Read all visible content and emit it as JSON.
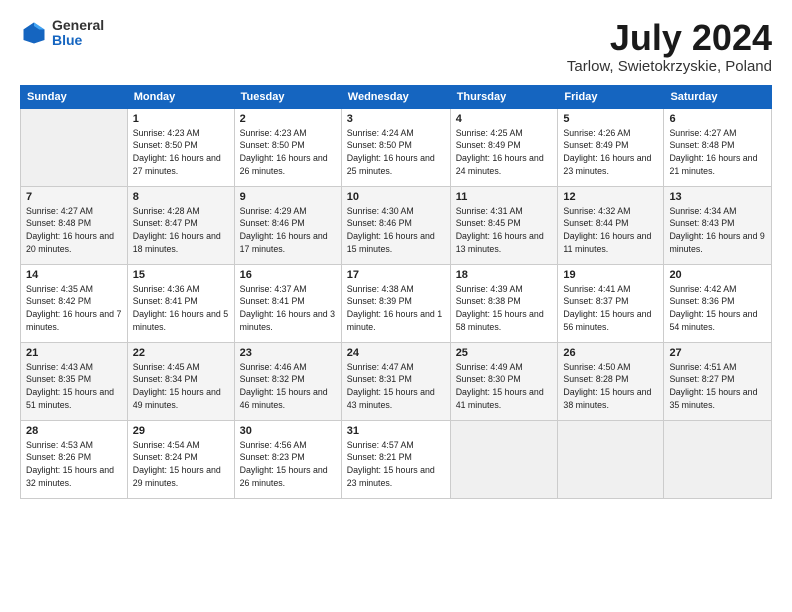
{
  "header": {
    "logo_general": "General",
    "logo_blue": "Blue",
    "month_title": "July 2024",
    "location": "Tarlow, Swietokrzyskie, Poland"
  },
  "days_of_week": [
    "Sunday",
    "Monday",
    "Tuesday",
    "Wednesday",
    "Thursday",
    "Friday",
    "Saturday"
  ],
  "weeks": [
    [
      {
        "day": "",
        "info": ""
      },
      {
        "day": "1",
        "info": "Sunrise: 4:23 AM\nSunset: 8:50 PM\nDaylight: 16 hours\nand 27 minutes."
      },
      {
        "day": "2",
        "info": "Sunrise: 4:23 AM\nSunset: 8:50 PM\nDaylight: 16 hours\nand 26 minutes."
      },
      {
        "day": "3",
        "info": "Sunrise: 4:24 AM\nSunset: 8:50 PM\nDaylight: 16 hours\nand 25 minutes."
      },
      {
        "day": "4",
        "info": "Sunrise: 4:25 AM\nSunset: 8:49 PM\nDaylight: 16 hours\nand 24 minutes."
      },
      {
        "day": "5",
        "info": "Sunrise: 4:26 AM\nSunset: 8:49 PM\nDaylight: 16 hours\nand 23 minutes."
      },
      {
        "day": "6",
        "info": "Sunrise: 4:27 AM\nSunset: 8:48 PM\nDaylight: 16 hours\nand 21 minutes."
      }
    ],
    [
      {
        "day": "7",
        "info": "Sunrise: 4:27 AM\nSunset: 8:48 PM\nDaylight: 16 hours\nand 20 minutes."
      },
      {
        "day": "8",
        "info": "Sunrise: 4:28 AM\nSunset: 8:47 PM\nDaylight: 16 hours\nand 18 minutes."
      },
      {
        "day": "9",
        "info": "Sunrise: 4:29 AM\nSunset: 8:46 PM\nDaylight: 16 hours\nand 17 minutes."
      },
      {
        "day": "10",
        "info": "Sunrise: 4:30 AM\nSunset: 8:46 PM\nDaylight: 16 hours\nand 15 minutes."
      },
      {
        "day": "11",
        "info": "Sunrise: 4:31 AM\nSunset: 8:45 PM\nDaylight: 16 hours\nand 13 minutes."
      },
      {
        "day": "12",
        "info": "Sunrise: 4:32 AM\nSunset: 8:44 PM\nDaylight: 16 hours\nand 11 minutes."
      },
      {
        "day": "13",
        "info": "Sunrise: 4:34 AM\nSunset: 8:43 PM\nDaylight: 16 hours\nand 9 minutes."
      }
    ],
    [
      {
        "day": "14",
        "info": "Sunrise: 4:35 AM\nSunset: 8:42 PM\nDaylight: 16 hours\nand 7 minutes."
      },
      {
        "day": "15",
        "info": "Sunrise: 4:36 AM\nSunset: 8:41 PM\nDaylight: 16 hours\nand 5 minutes."
      },
      {
        "day": "16",
        "info": "Sunrise: 4:37 AM\nSunset: 8:41 PM\nDaylight: 16 hours\nand 3 minutes."
      },
      {
        "day": "17",
        "info": "Sunrise: 4:38 AM\nSunset: 8:39 PM\nDaylight: 16 hours\nand 1 minute."
      },
      {
        "day": "18",
        "info": "Sunrise: 4:39 AM\nSunset: 8:38 PM\nDaylight: 15 hours\nand 58 minutes."
      },
      {
        "day": "19",
        "info": "Sunrise: 4:41 AM\nSunset: 8:37 PM\nDaylight: 15 hours\nand 56 minutes."
      },
      {
        "day": "20",
        "info": "Sunrise: 4:42 AM\nSunset: 8:36 PM\nDaylight: 15 hours\nand 54 minutes."
      }
    ],
    [
      {
        "day": "21",
        "info": "Sunrise: 4:43 AM\nSunset: 8:35 PM\nDaylight: 15 hours\nand 51 minutes."
      },
      {
        "day": "22",
        "info": "Sunrise: 4:45 AM\nSunset: 8:34 PM\nDaylight: 15 hours\nand 49 minutes."
      },
      {
        "day": "23",
        "info": "Sunrise: 4:46 AM\nSunset: 8:32 PM\nDaylight: 15 hours\nand 46 minutes."
      },
      {
        "day": "24",
        "info": "Sunrise: 4:47 AM\nSunset: 8:31 PM\nDaylight: 15 hours\nand 43 minutes."
      },
      {
        "day": "25",
        "info": "Sunrise: 4:49 AM\nSunset: 8:30 PM\nDaylight: 15 hours\nand 41 minutes."
      },
      {
        "day": "26",
        "info": "Sunrise: 4:50 AM\nSunset: 8:28 PM\nDaylight: 15 hours\nand 38 minutes."
      },
      {
        "day": "27",
        "info": "Sunrise: 4:51 AM\nSunset: 8:27 PM\nDaylight: 15 hours\nand 35 minutes."
      }
    ],
    [
      {
        "day": "28",
        "info": "Sunrise: 4:53 AM\nSunset: 8:26 PM\nDaylight: 15 hours\nand 32 minutes."
      },
      {
        "day": "29",
        "info": "Sunrise: 4:54 AM\nSunset: 8:24 PM\nDaylight: 15 hours\nand 29 minutes."
      },
      {
        "day": "30",
        "info": "Sunrise: 4:56 AM\nSunset: 8:23 PM\nDaylight: 15 hours\nand 26 minutes."
      },
      {
        "day": "31",
        "info": "Sunrise: 4:57 AM\nSunset: 8:21 PM\nDaylight: 15 hours\nand 23 minutes."
      },
      {
        "day": "",
        "info": ""
      },
      {
        "day": "",
        "info": ""
      },
      {
        "day": "",
        "info": ""
      }
    ]
  ]
}
